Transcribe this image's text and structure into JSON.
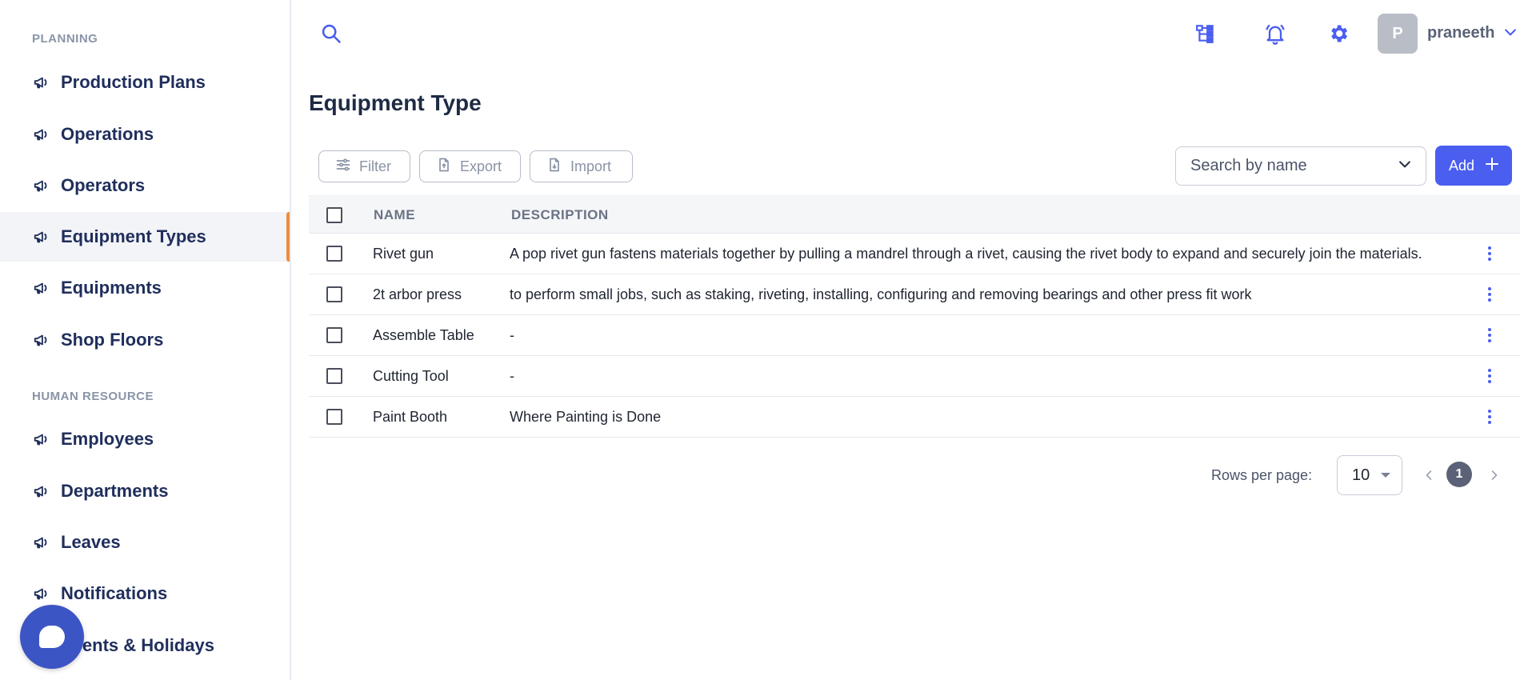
{
  "sidebar": {
    "sections": [
      {
        "title": "PLANNING"
      },
      {
        "title": "HUMAN RESOURCE"
      }
    ],
    "items": [
      {
        "label": "Production Plans",
        "icon": "megaphone-icon"
      },
      {
        "label": "Operations",
        "icon": "megaphone-icon"
      },
      {
        "label": "Operators",
        "icon": "megaphone-icon"
      },
      {
        "label": "Equipment Types",
        "icon": "megaphone-icon",
        "active": true
      },
      {
        "label": "Equipments",
        "icon": "megaphone-icon"
      },
      {
        "label": "Shop Floors",
        "icon": "megaphone-icon"
      },
      {
        "label": "Employees",
        "icon": "megaphone-icon"
      },
      {
        "label": "Departments",
        "icon": "megaphone-icon"
      },
      {
        "label": "Leaves",
        "icon": "megaphone-icon"
      },
      {
        "label": "Notifications",
        "icon": "megaphone-icon"
      },
      {
        "label": "Events & Holidays",
        "icon": "megaphone-icon"
      }
    ],
    "active_accent": "#f08c3c"
  },
  "topbar": {
    "icons": [
      "search-icon",
      "hierarchy-icon",
      "bell-icon",
      "gear-icon"
    ],
    "user": {
      "initial": "P",
      "name": "praneeth"
    }
  },
  "page": {
    "title": "Equipment Type"
  },
  "toolbar": {
    "filter_label": "Filter",
    "export_label": "Export",
    "import_label": "Import",
    "search_placeholder": "Search by name",
    "add_label": "Add"
  },
  "table": {
    "columns": [
      "NAME",
      "DESCRIPTION"
    ],
    "rows": [
      {
        "name": "Rivet gun",
        "description": "A pop rivet gun fastens materials together by pulling a mandrel through a rivet, causing the rivet body to expand and securely join the materials."
      },
      {
        "name": "2t arbor press",
        "description": "to perform small jobs, such as staking, riveting, installing, configuring and removing bearings and other press fit work"
      },
      {
        "name": "Assemble Table",
        "description": "-"
      },
      {
        "name": "Cutting Tool",
        "description": "-"
      },
      {
        "name": "Paint Booth",
        "description": "Where Painting is Done"
      }
    ]
  },
  "pagination": {
    "rows_per_page_label": "Rows per page:",
    "rows_per_page": "10",
    "current_page": "1"
  },
  "colors": {
    "primary": "#4a5ef0",
    "sidebar_text": "#1f2e5c",
    "chat_bubble": "#3c55c4"
  }
}
